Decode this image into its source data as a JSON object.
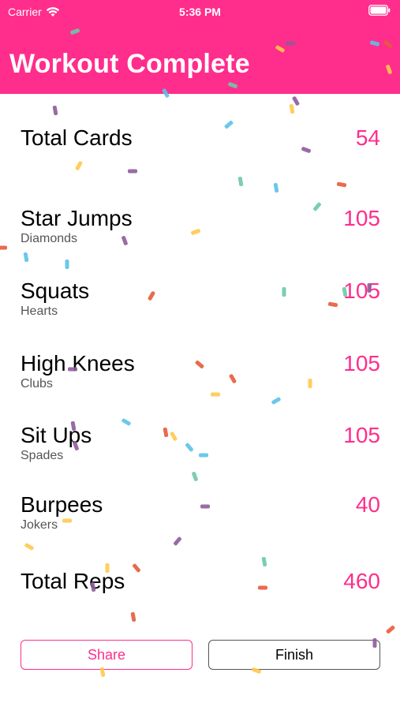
{
  "status_bar": {
    "carrier": "Carrier",
    "time": "5:36 PM"
  },
  "title": "Workout Complete",
  "summary": {
    "total_cards": {
      "label": "Total Cards",
      "value": "54"
    },
    "exercises": [
      {
        "label": "Star Jumps",
        "suit": "Diamonds",
        "value": "105"
      },
      {
        "label": "Squats",
        "suit": "Hearts",
        "value": "105"
      },
      {
        "label": "High Knees",
        "suit": "Clubs",
        "value": "105"
      },
      {
        "label": "Sit Ups",
        "suit": "Spades",
        "value": "105"
      },
      {
        "label": "Burpees",
        "suit": "Jokers",
        "value": "40"
      }
    ],
    "total_reps": {
      "label": "Total Reps",
      "value": "460"
    }
  },
  "buttons": {
    "share": "Share",
    "finish": "Finish"
  },
  "colors": {
    "accent": "#ff2d8c",
    "confetti": [
      "#8e5b9a",
      "#5bc2e7",
      "#ffc94d",
      "#6ec9a5",
      "#e85a3c"
    ]
  }
}
